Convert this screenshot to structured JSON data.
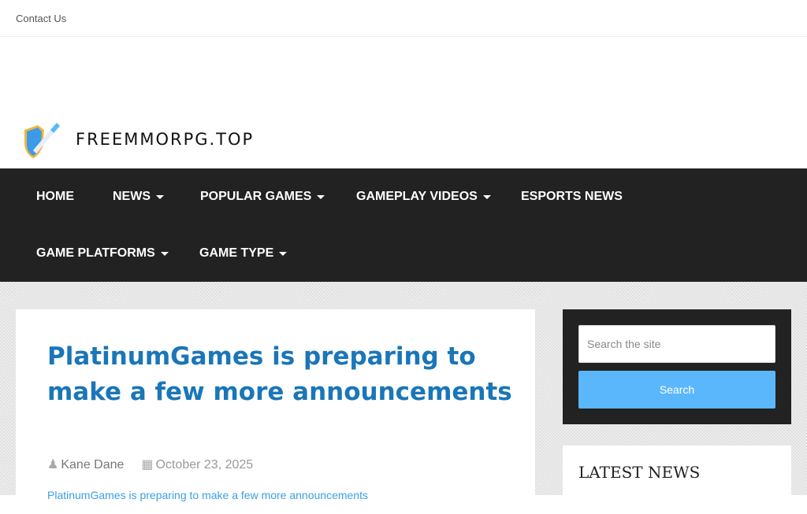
{
  "topbar": {
    "contact": "Contact Us"
  },
  "logo": {
    "text": "FREEMMORPG.TOP"
  },
  "nav": {
    "items": [
      {
        "label": "HOME",
        "dropdown": false
      },
      {
        "label": "NEWS",
        "dropdown": true
      },
      {
        "label": "POPULAR GAMES",
        "dropdown": true
      },
      {
        "label": "GAMEPLAY VIDEOS",
        "dropdown": true
      },
      {
        "label": "ESPORTS NEWS",
        "dropdown": false
      },
      {
        "label": "GAME PLATFORMS",
        "dropdown": true
      },
      {
        "label": "GAME TYPE",
        "dropdown": true
      }
    ]
  },
  "article": {
    "title": "PlatinumGames is preparing to make a few more announcements",
    "author": "Kane Dane",
    "date": "October 23, 2025",
    "image_alt": "PlatinumGames is preparing to make a few more announcements"
  },
  "sidebar": {
    "search_placeholder": "Search the site",
    "search_button": "Search",
    "latest_title": "LATEST NEWS"
  }
}
